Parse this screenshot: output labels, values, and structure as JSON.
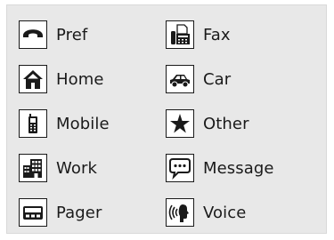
{
  "accent_color": "#1a1a1a",
  "background_color": "#e8e8e8",
  "left_column": [
    {
      "label": "Pref",
      "icon": "phone-handset-icon"
    },
    {
      "label": "Home",
      "icon": "house-icon"
    },
    {
      "label": "Mobile",
      "icon": "mobile-phone-icon"
    },
    {
      "label": "Work",
      "icon": "office-building-icon"
    },
    {
      "label": "Pager",
      "icon": "pager-icon"
    }
  ],
  "right_column": [
    {
      "label": "Fax",
      "icon": "fax-machine-icon"
    },
    {
      "label": "Car",
      "icon": "car-icon"
    },
    {
      "label": "Other",
      "icon": "star-icon"
    },
    {
      "label": "Message",
      "icon": "speech-bubble-icon"
    },
    {
      "label": "Voice",
      "icon": "voice-speaking-icon"
    }
  ]
}
